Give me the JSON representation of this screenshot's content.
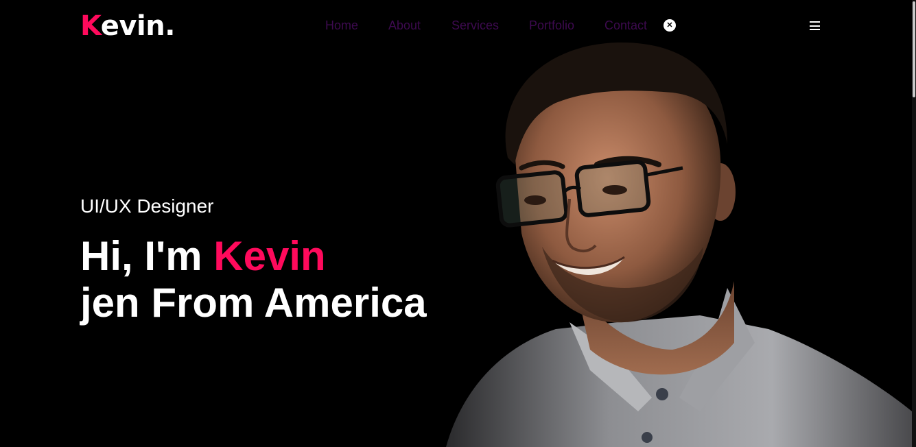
{
  "header": {
    "logo_main": "K",
    "logo_rest": "evin.",
    "nav": [
      {
        "label": "Home"
      },
      {
        "label": "About"
      },
      {
        "label": "Services"
      },
      {
        "label": "Portfolio"
      },
      {
        "label": "Contact"
      }
    ],
    "close_icon": "close-icon",
    "menu_icon": "hamburger-menu-icon"
  },
  "hero": {
    "subtitle": "UI/UX Designer",
    "greeting": "Hi, I'm ",
    "name": "Kevin",
    "line2": "jen From America",
    "portrait_icon": "portrait-photo"
  },
  "colors": {
    "accent": "#ff0a5c",
    "background": "#000000",
    "nav_text": "#3d0a4f",
    "text": "#ffffff"
  }
}
